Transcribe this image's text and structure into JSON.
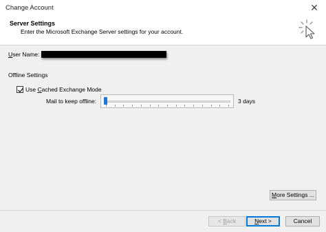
{
  "window": {
    "title": "Change Account",
    "close_glyph": "✕"
  },
  "header": {
    "title": "Server Settings",
    "subtitle": "Enter the Microsoft Exchange Server settings for your account.",
    "icon": "cursor-click-icon"
  },
  "user_name": {
    "label_underlined": "U",
    "label_rest": "ser Name:"
  },
  "offline": {
    "section_label": "Offline Settings",
    "cached_mode": {
      "label_pre": "Use ",
      "label_underlined": "C",
      "label_rest": "ached Exchange Mode",
      "checked": true
    },
    "mail_offline": {
      "label": "Mail to keep offline:",
      "value_text": "3 days",
      "slider_fraction": 0.0
    }
  },
  "buttons": {
    "more_settings": {
      "pre": "",
      "u": "M",
      "rest": "ore Settings ..."
    },
    "back": {
      "pre": "< ",
      "u": "B",
      "rest": "ack"
    },
    "next": {
      "pre": "",
      "u": "N",
      "rest": "ext >"
    },
    "cancel": "Cancel"
  },
  "colors": {
    "slider_thumb": "#1a78d6",
    "default_button_border": "#0078d7"
  }
}
